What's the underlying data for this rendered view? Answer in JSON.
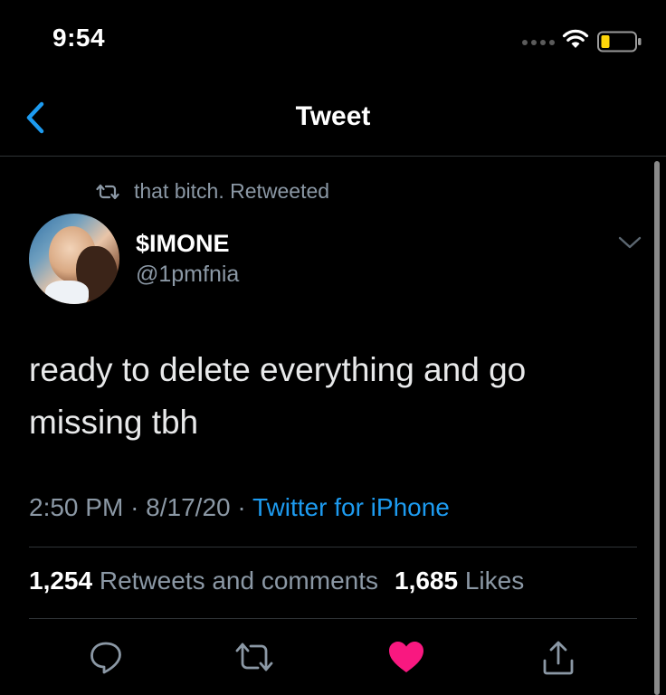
{
  "status_bar": {
    "time": "9:54"
  },
  "nav": {
    "title": "Tweet",
    "back_icon": "chevron-left-icon"
  },
  "tweet": {
    "retweet_context": "that bitch. Retweeted",
    "author": {
      "name": "$IMONE",
      "handle": "@1pmfnia"
    },
    "text_line_1": "ready to delete everything and go",
    "text_line_2": "missing tbh",
    "time": "2:50 PM",
    "date": "8/17/20",
    "separator": "·",
    "source": "Twitter for iPhone",
    "retweets_count": "1,254",
    "retweets_label": "Retweets and comments",
    "likes_count": "1,685",
    "likes_label": "Likes",
    "liked": true
  },
  "actions": [
    "reply-icon",
    "retweet-icon",
    "like-icon",
    "share-icon"
  ],
  "colors": {
    "background": "#000000",
    "accent": "#1d9bf0",
    "like": "#f91880",
    "secondary_text": "#8b98a5",
    "divider": "#2f3336"
  }
}
